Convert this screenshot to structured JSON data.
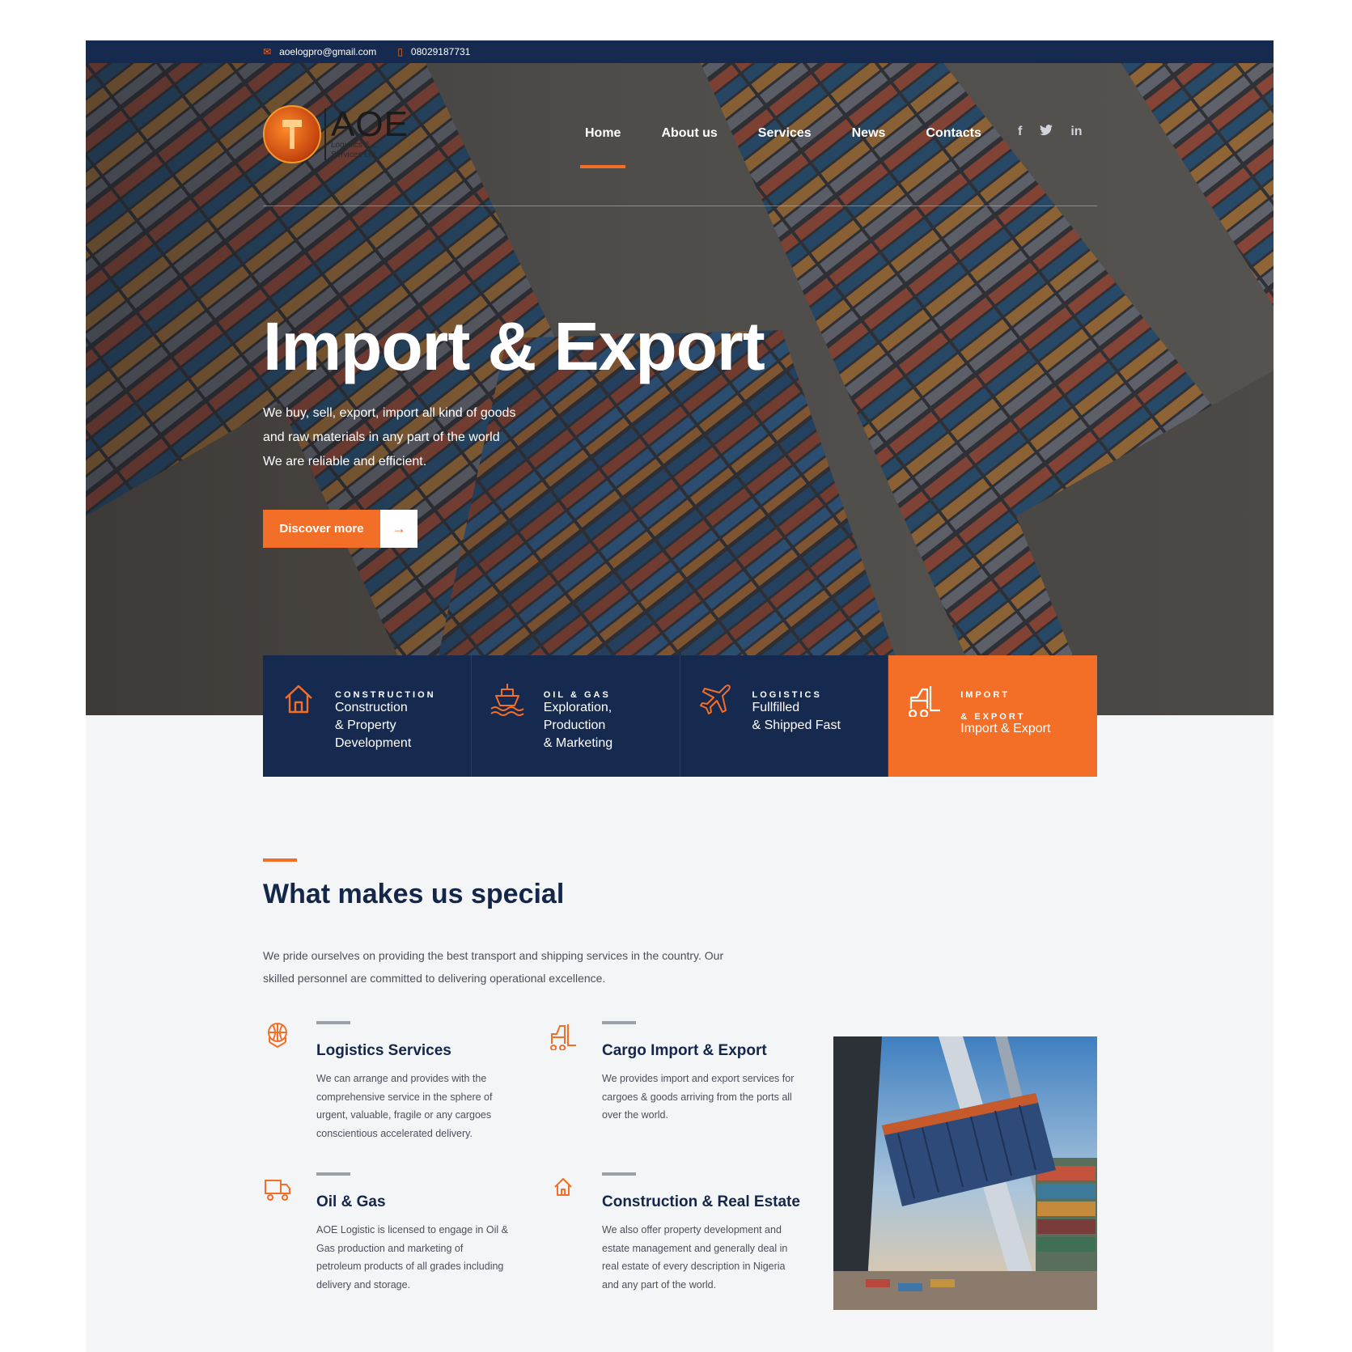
{
  "topbar": {
    "email": "aoelogpro@gmail.com",
    "phone": "08029187731"
  },
  "logo": {
    "name": "AOE",
    "tagline_line1": "Logistics & ...",
    "tagline_line2": "Services Ltd"
  },
  "nav": {
    "items": [
      "Home",
      "About us",
      "Services",
      "News",
      "Contacts"
    ],
    "active": "Home"
  },
  "social": [
    "f",
    "t",
    "in"
  ],
  "hero": {
    "title": "Import & Export",
    "lines": [
      "We buy, sell, export, import all kind of goods",
      "and raw materials in any part of the world",
      "We are reliable and efficient."
    ],
    "cta_label": "Discover more",
    "cta_arrow": "→"
  },
  "features": [
    {
      "category": "CONSTRUCTION",
      "desc": [
        "Construction",
        "& Property",
        "Development"
      ],
      "icon": "house-icon"
    },
    {
      "category": "OIL & GAS",
      "desc": [
        "Exploration,",
        "Production",
        "& Marketing"
      ],
      "icon": "ship-icon"
    },
    {
      "category": "LOGISTICS",
      "desc": [
        "Fullfilled",
        "& Shipped Fast"
      ],
      "icon": "airplane-icon"
    },
    {
      "category_line1": "IMPORT",
      "category_line2": "& EXPORT",
      "desc": [
        "Import & Export"
      ],
      "icon": "forklift-icon"
    }
  ],
  "special": {
    "title": "What makes us special",
    "text_line1": "We pride ourselves on providing the best transport and shipping services in the country. Our",
    "text_line2": "skilled personnel are committed to delivering operational excellence."
  },
  "services": [
    {
      "title": "Logistics Services",
      "icon": "globe-box-icon",
      "lines": [
        "We can arrange and provides with the",
        "comprehensive service in the sphere of",
        "urgent, valuable, fragile or any cargoes",
        "conscientious accelerated delivery."
      ]
    },
    {
      "title": "Cargo Import & Export",
      "icon": "forklift-icon",
      "lines": [
        "We provides import and export services for",
        "cargoes & goods arriving from the ports all",
        "over the world."
      ]
    },
    {
      "title": "Oil & Gas",
      "icon": "truck-icon",
      "lines": [
        "AOE Logistic is licensed to engage in Oil &",
        "Gas production and marketing of",
        "petroleum products of all grades including",
        "delivery and storage."
      ]
    },
    {
      "title": "Construction & Real Estate",
      "icon": "house-icon",
      "lines": [
        "We also offer property development and",
        "estate management and generally deal in",
        "real estate of every description in Nigeria",
        "and any part of the world."
      ]
    }
  ],
  "colors": {
    "navy": "#16294f",
    "orange": "#f36e26",
    "background": "#f4f5f7"
  }
}
